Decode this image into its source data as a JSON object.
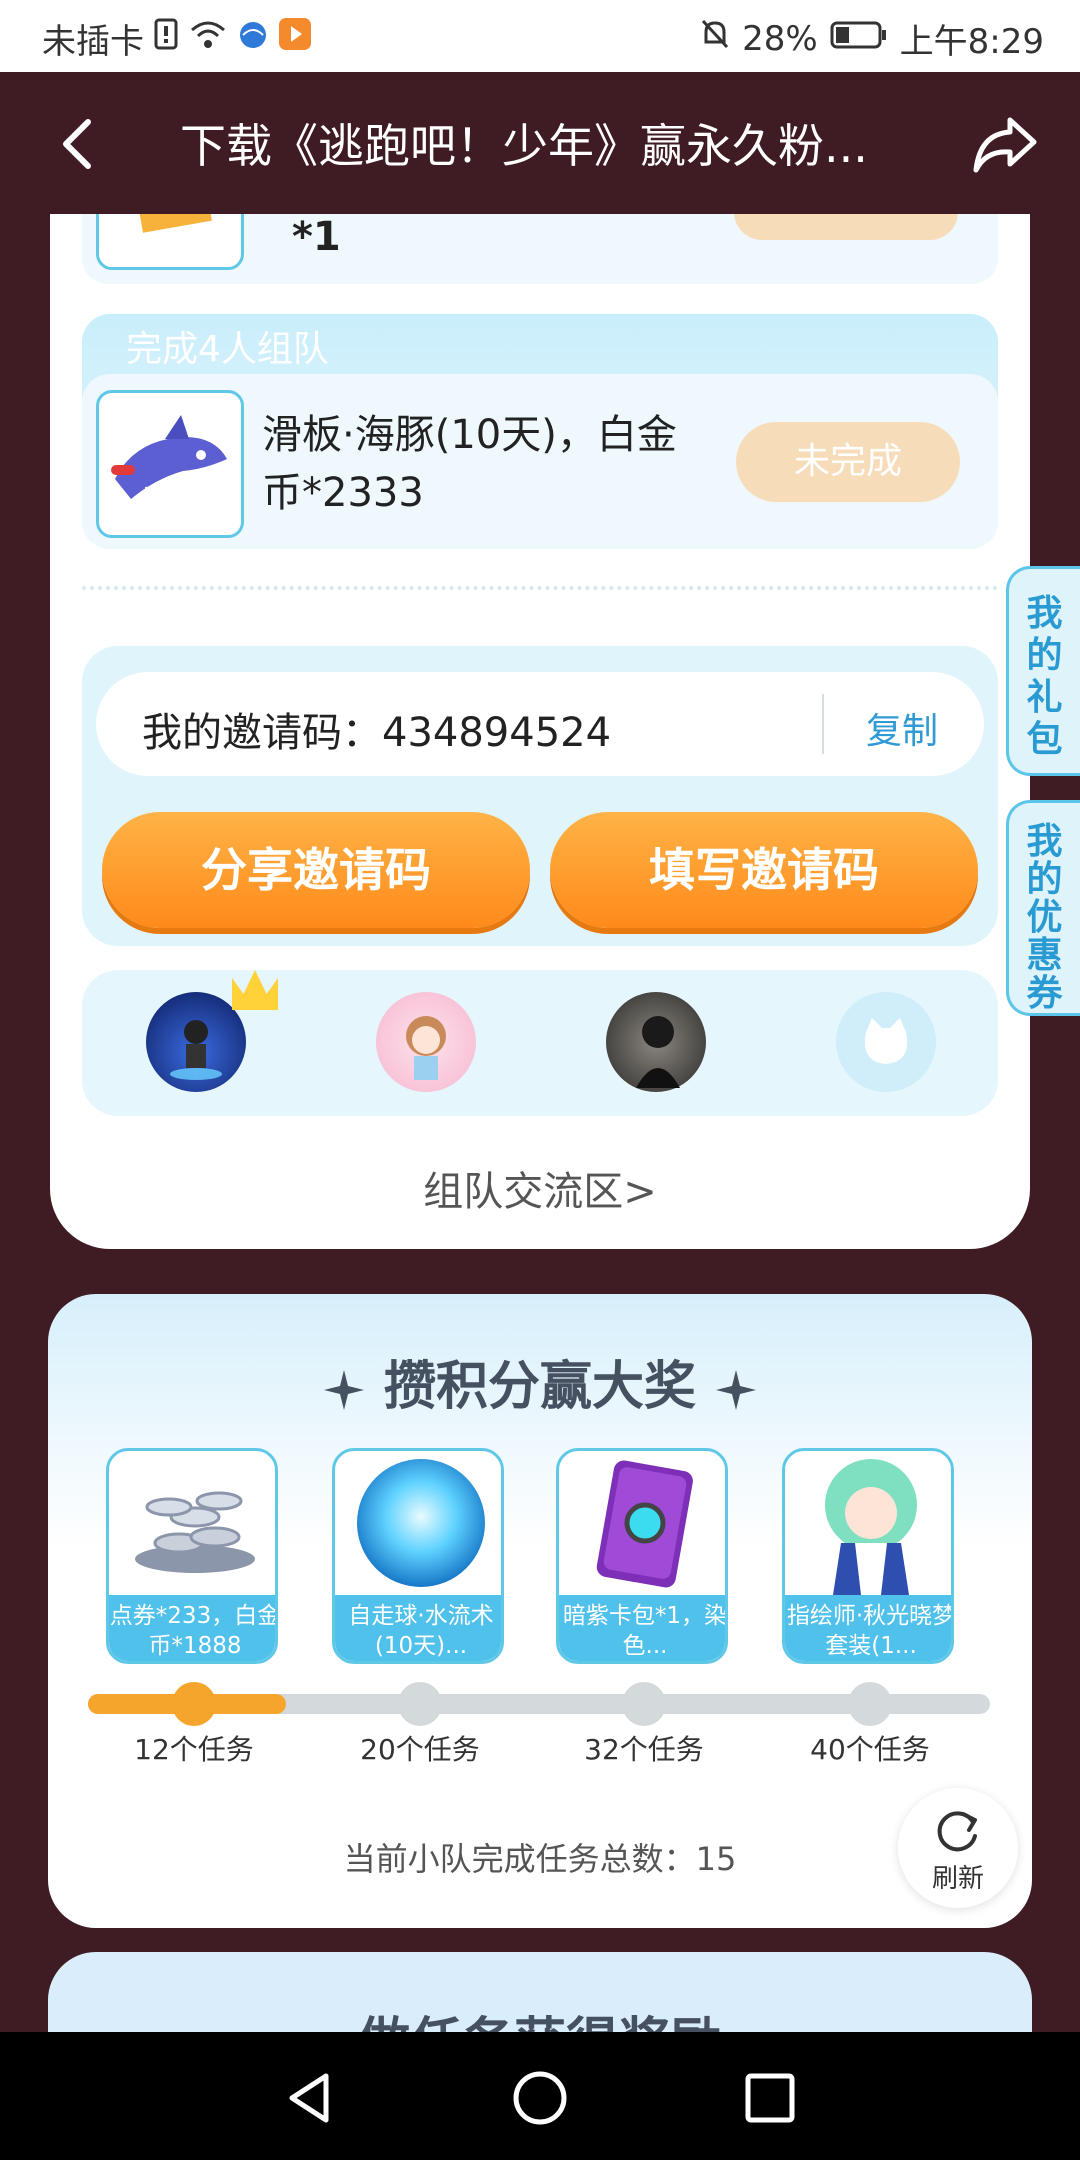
{
  "status_bar": {
    "carrier": "未插卡",
    "battery_pct": "28%",
    "time": "上午8:29"
  },
  "header": {
    "title": "下载《逃跑吧！少年》赢永久粉..."
  },
  "prev_task": {
    "text": "*1"
  },
  "team_task": {
    "tag": "完成4人组队",
    "desc": "滑板·海豚(10天)，白金币*2333",
    "status": "未完成"
  },
  "invite": {
    "code_label": "我的邀请码：434894524",
    "copy": "复制",
    "share_button": "分享邀请码",
    "fill_button": "填写邀请码"
  },
  "team_link": "组队交流区>",
  "side_tabs": {
    "gift": [
      "我",
      "的",
      "礼",
      "包"
    ],
    "coupon": [
      "我",
      "的",
      "优",
      "惠",
      "券"
    ]
  },
  "rewards": {
    "title": "攒积分赢大奖",
    "prizes": [
      {
        "caption": "点券*233，白金币*1888",
        "milestone": "12个任务"
      },
      {
        "caption": "自走球·水流术(10天)...",
        "milestone": "20个任务"
      },
      {
        "caption": "暗紫卡包*1，染色...",
        "milestone": "32个任务"
      },
      {
        "caption": "指绘师·秋光晓梦套装(1...",
        "milestone": "40个任务"
      }
    ],
    "progress_fraction": 0.22,
    "total_text": "当前小队完成任务总数：15",
    "refresh": "刷新"
  },
  "next_section_title": "做任务获得奖励",
  "colors": {
    "header_bg": "#3f1b24",
    "accent_orange": "#ff8a1a",
    "accent_blue": "#4fc1ea",
    "status_pending": "#f7dcb9"
  }
}
